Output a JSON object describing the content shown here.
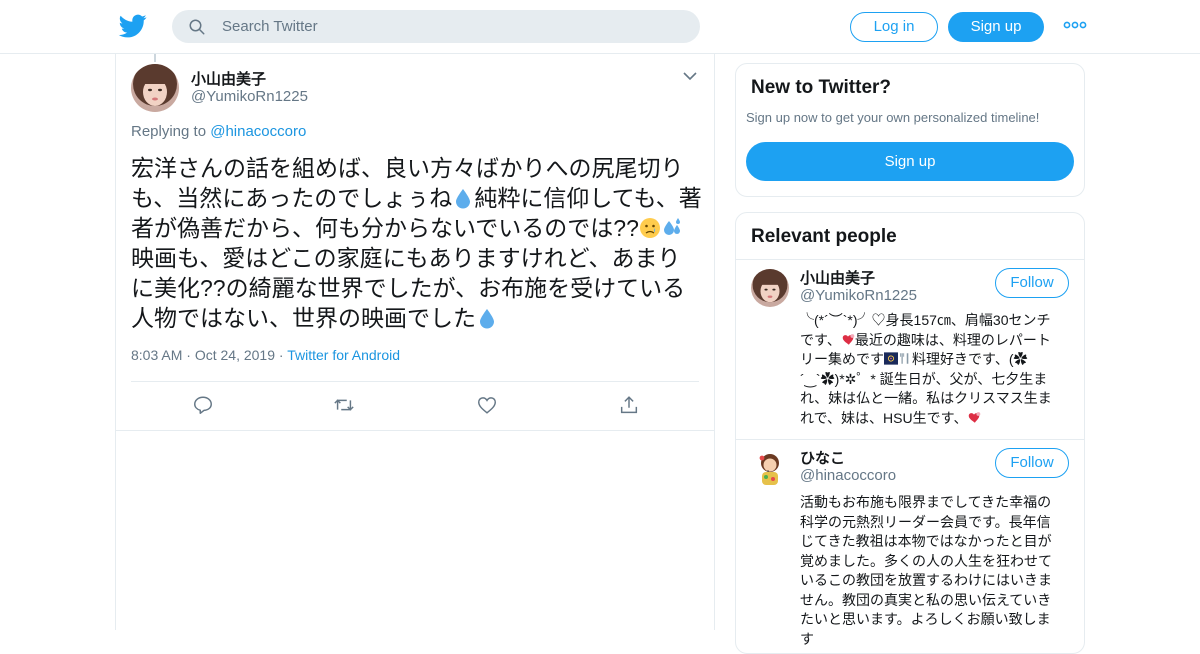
{
  "header": {
    "search_placeholder": "Search Twitter",
    "login_label": "Log in",
    "signup_label": "Sign up"
  },
  "tweet": {
    "author_name": "小山由美子",
    "author_handle": "@YumikoRn1225",
    "replying_prefix": "Replying to",
    "replying_to": "@hinacoccoro",
    "text_part1": "宏洋さんの話を組めば、良い方々ばかりへの尻尾切りも、当然にあったのでしょぅね",
    "text_part2": "純粋に信仰しても、著者が偽善だから、何も分からないでいるのでは??",
    "text_part3": "映画も、愛はどこの家庭にもありますけれど、あまりに美化??の綺麗な世界でしたが、お布施を受けている人物ではない、世界の映画でした",
    "time": "8:03 AM",
    "date": "Oct 24, 2019",
    "source": "Twitter for Android",
    "sep": "·"
  },
  "new_to_twitter": {
    "title": "New to Twitter?",
    "subtitle": "Sign up now to get your own personalized timeline!",
    "signup_label": "Sign up"
  },
  "relevant_people": {
    "title": "Relevant people",
    "people": [
      {
        "name": "小山由美子",
        "handle": "@YumikoRn1225",
        "follow_label": "Follow",
        "bio_part1": "╰(*´︶`*)╯♡身長157㎝、肩幅30センチです、",
        "bio_part2": "最近の趣味は、料理のレパートリー集めです",
        "bio_part3": "料理好きです、(✿´‿`✿)*✲゜* 誕生日が、父が、七夕生まれ、妹は仏と一緒。私はクリスマス生まれで、妹は、HSU生です、"
      },
      {
        "name": "ひなこ",
        "handle": "@hinacoccoro",
        "follow_label": "Follow",
        "bio": "活動もお布施も限界までしてきた幸福の科学の元熱烈リーダー会員です。長年信じてきた教祖は本物ではなかったと目が覚めました。多くの人の人生を狂わせているこの教団を放置するわけにはいきません。教団の真実と私の思い伝えていきたいと思います。よろしくお願い致します"
      }
    ]
  }
}
